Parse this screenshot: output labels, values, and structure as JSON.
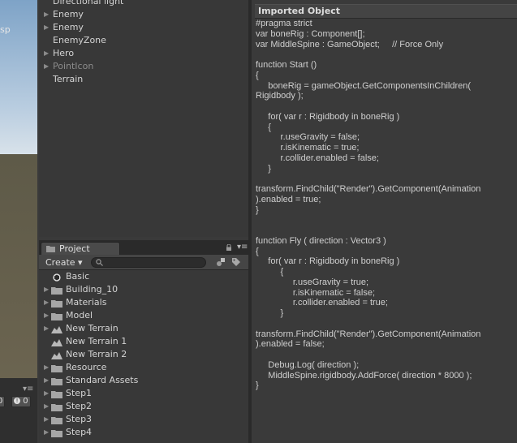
{
  "scene": {
    "persp_label": "sp",
    "counters": [
      "0",
      "0"
    ]
  },
  "hierarchy": {
    "items": [
      {
        "label": "Directional light",
        "arrow": false,
        "dim": false
      },
      {
        "label": "Enemy",
        "arrow": true,
        "dim": false
      },
      {
        "label": "Enemy",
        "arrow": true,
        "dim": false
      },
      {
        "label": "EnemyZone",
        "arrow": false,
        "dim": false
      },
      {
        "label": "Hero",
        "arrow": true,
        "dim": false
      },
      {
        "label": "PointIcon",
        "arrow": true,
        "dim": true
      },
      {
        "label": "Terrain",
        "arrow": false,
        "dim": false
      }
    ]
  },
  "project": {
    "tab_label": "Project",
    "create_label": "Create ▾",
    "search_placeholder": "",
    "items": [
      {
        "label": "Basic",
        "arrow": false,
        "icon": "unity-icon"
      },
      {
        "label": "Building_10",
        "arrow": true,
        "icon": "folder-icon"
      },
      {
        "label": "Materials",
        "arrow": true,
        "icon": "folder-icon"
      },
      {
        "label": "Model",
        "arrow": true,
        "icon": "folder-icon"
      },
      {
        "label": "New Terrain",
        "arrow": true,
        "icon": "terrain-icon"
      },
      {
        "label": "New Terrain 1",
        "arrow": false,
        "icon": "terrain-icon"
      },
      {
        "label": "New Terrain 2",
        "arrow": false,
        "icon": "terrain-icon"
      },
      {
        "label": "Resource",
        "arrow": true,
        "icon": "folder-icon"
      },
      {
        "label": "Standard Assets",
        "arrow": true,
        "icon": "folder-icon"
      },
      {
        "label": "Step1",
        "arrow": true,
        "icon": "folder-icon"
      },
      {
        "label": "Step2",
        "arrow": true,
        "icon": "folder-icon"
      },
      {
        "label": "Step3",
        "arrow": true,
        "icon": "folder-icon"
      },
      {
        "label": "Step4",
        "arrow": true,
        "icon": "folder-icon"
      }
    ]
  },
  "inspector": {
    "header": "Imported Object",
    "code": "#pragma strict\nvar boneRig : Component[];\nvar MiddleSpine : GameObject;     // Force Only\n\nfunction Start ()\n{\n     boneRig = gameObject.GetComponentsInChildren(\nRigidbody );\n\n     for( var r : Rigidbody in boneRig )\n     {\n          r.useGravity = false;\n          r.isKinematic = true;\n          r.collider.enabled = false;\n     }\n\ntransform.FindChild(\"Render\").GetComponent(Animation\n).enabled = true;\n}\n\n\nfunction Fly ( direction : Vector3 )\n{\n     for( var r : Rigidbody in boneRig )\n          {\n               r.useGravity = true;\n               r.isKinematic = false;\n               r.collider.enabled = true;\n          }\n\ntransform.FindChild(\"Render\").GetComponent(Animation\n).enabled = false;\n\n     Debug.Log( direction );\n     MiddleSpine.rigidbody.AddForce( direction * 8000 );\n}"
  },
  "colors": {
    "panel_bg": "#383838",
    "text": "#d4d4d4",
    "dim_text": "#8b8b8b",
    "sky": "#7ea3c7",
    "ground": "#5e5a48"
  }
}
